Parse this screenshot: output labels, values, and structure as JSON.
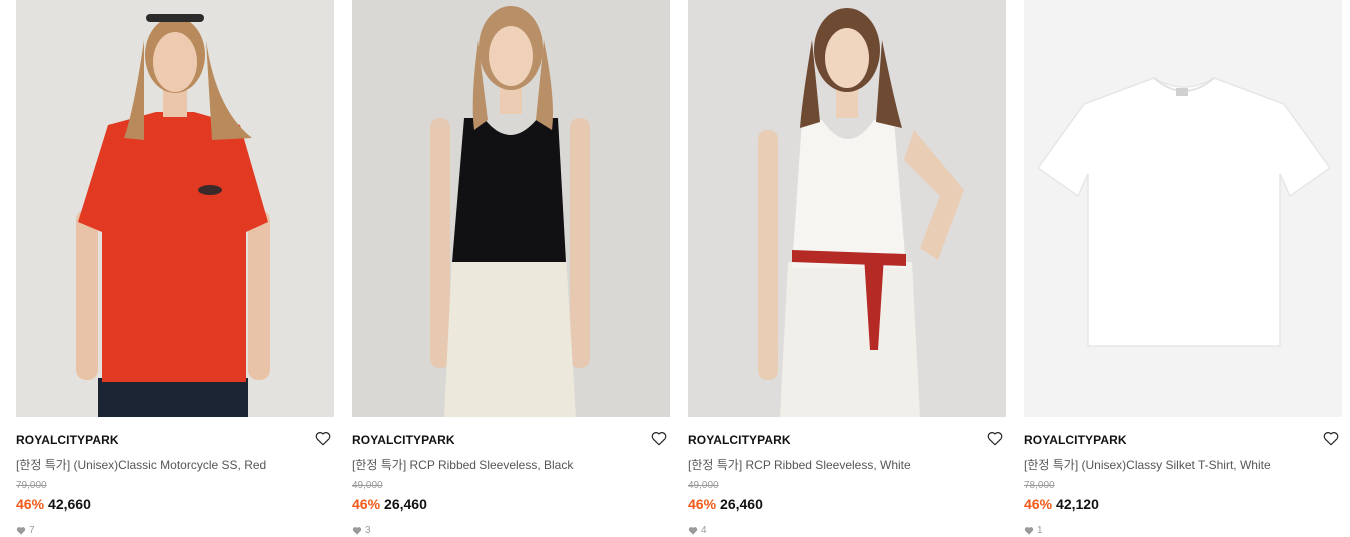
{
  "colors": {
    "discount": "#f25a1a",
    "muted": "#9a9a9a",
    "text": "#111111"
  },
  "products": [
    {
      "brand": "ROYALCITYPARK",
      "name": "[한정 특가] (Unisex)Classic Motorcycle SS, Red",
      "original_price": "79,000",
      "discount": "46%",
      "sale_price": "42,660",
      "likes": "7",
      "wish_icon": "heart-outline-icon"
    },
    {
      "brand": "ROYALCITYPARK",
      "name": "[한정 특가] RCP Ribbed Sleeveless, Black",
      "original_price": "49,000",
      "discount": "46%",
      "sale_price": "26,460",
      "likes": "3",
      "wish_icon": "heart-outline-icon"
    },
    {
      "brand": "ROYALCITYPARK",
      "name": "[한정 특가] RCP Ribbed Sleeveless, White",
      "original_price": "49,000",
      "discount": "46%",
      "sale_price": "26,460",
      "likes": "4",
      "wish_icon": "heart-outline-icon"
    },
    {
      "brand": "ROYALCITYPARK",
      "name": "[한정 특가] (Unisex)Classy Silket T-Shirt, White",
      "original_price": "78,000",
      "discount": "46%",
      "sale_price": "42,120",
      "likes": "1",
      "wish_icon": "heart-outline-icon"
    }
  ]
}
